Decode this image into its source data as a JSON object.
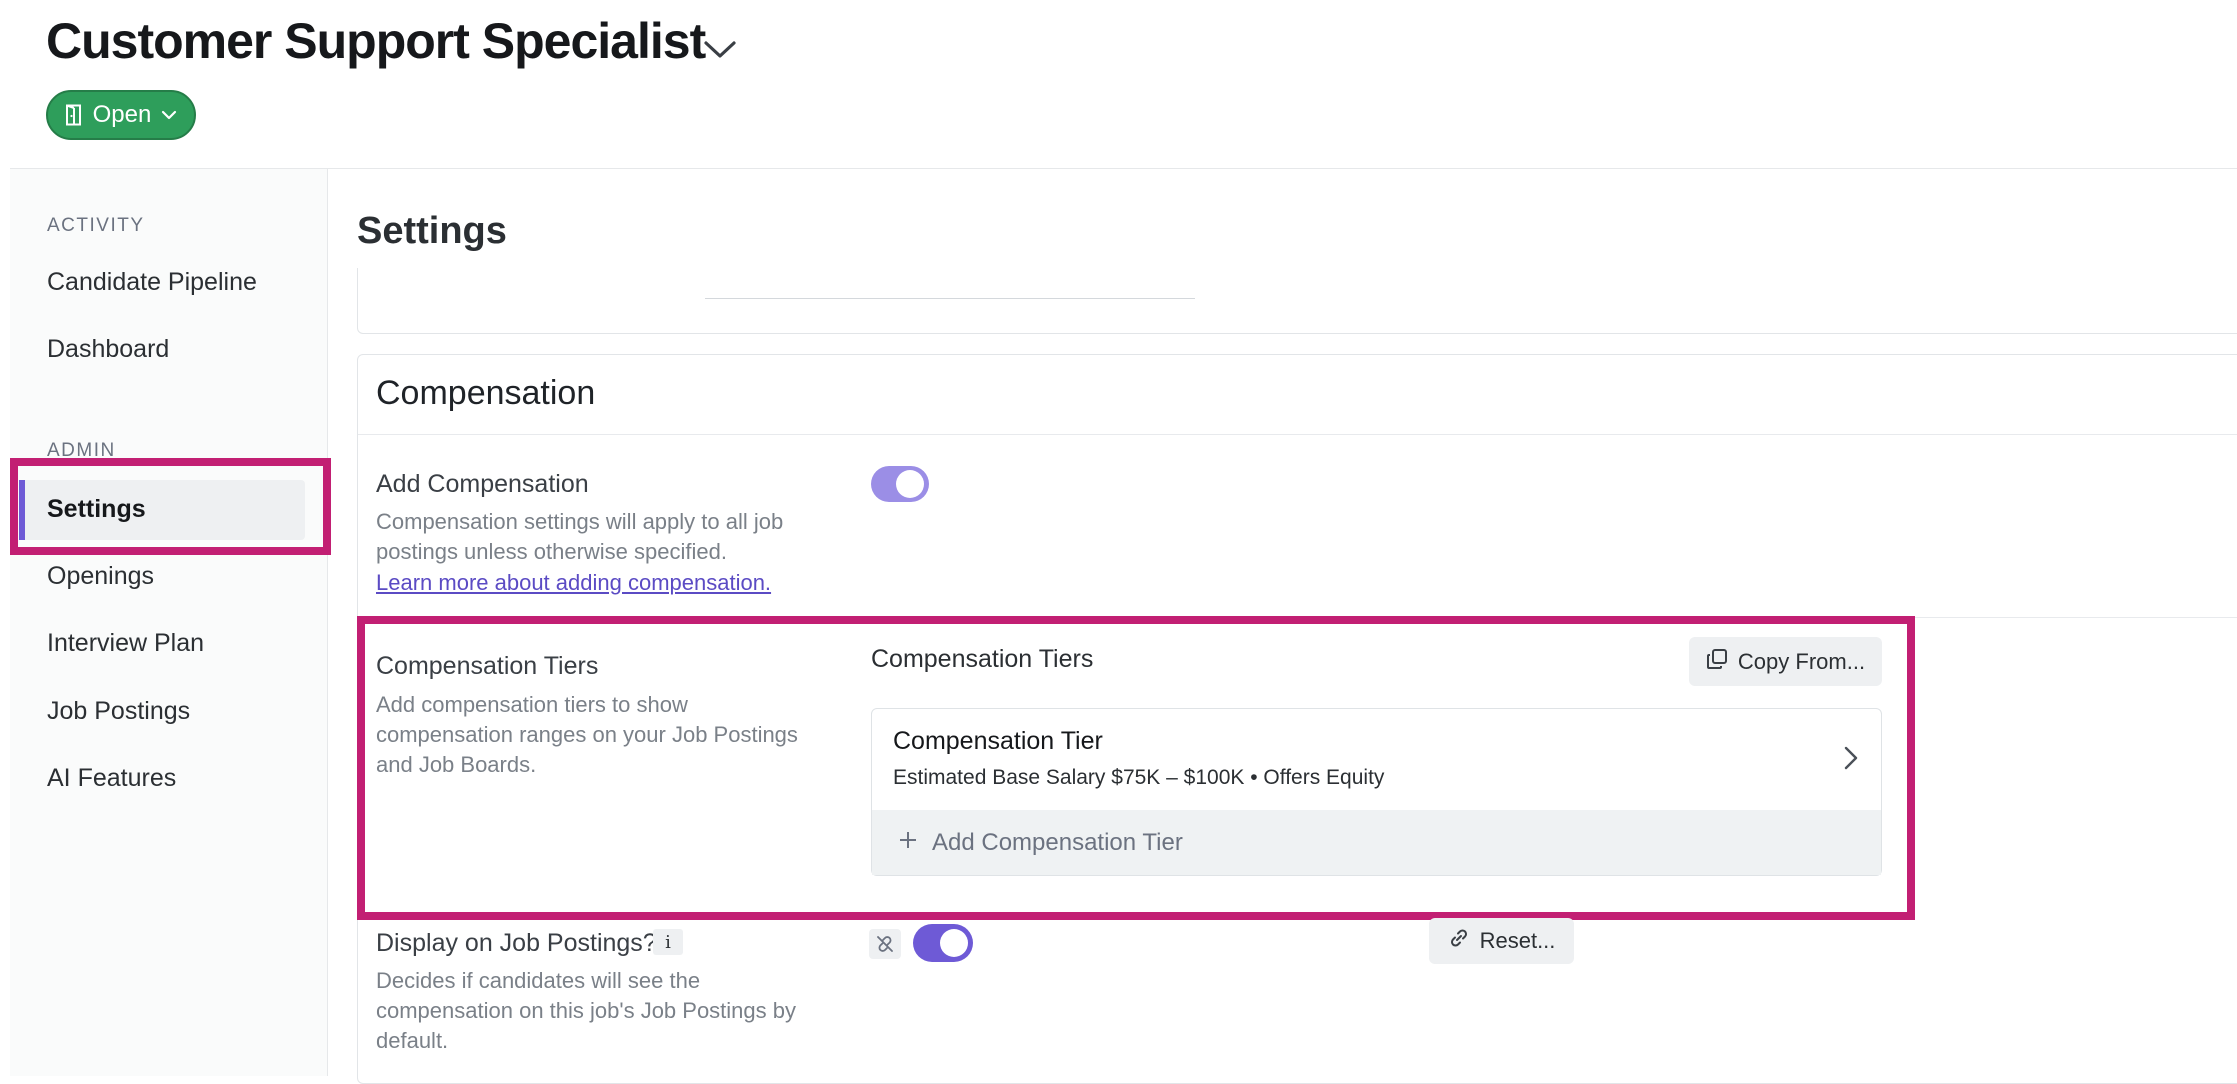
{
  "header": {
    "job_title": "Customer Support Specialist",
    "status_label": "Open"
  },
  "sidebar": {
    "activity_label": "ACTIVITY",
    "activity_items": [
      "Candidate Pipeline",
      "Dashboard"
    ],
    "admin_label": "ADMIN",
    "admin_items": [
      "Settings",
      "Openings",
      "Interview Plan",
      "Job Postings",
      "AI Features"
    ],
    "active_item": "Settings"
  },
  "main": {
    "title": "Settings",
    "compensation": {
      "heading": "Compensation",
      "add_compensation": {
        "title": "Add Compensation",
        "description": "Compensation settings will apply to all job postings unless otherwise specified.",
        "link": "Learn more about adding compensation.",
        "enabled": true
      },
      "tiers": {
        "title": "Compensation Tiers",
        "description": "Add compensation tiers to show compensation ranges on your Job Postings and Job Boards.",
        "panel_label": "Compensation Tiers",
        "copy_button": "Copy From...",
        "items": [
          {
            "name": "Compensation Tier",
            "detail": "Estimated Base Salary $75K – $100K • Offers Equity"
          }
        ],
        "add_label": "Add Compensation Tier"
      },
      "display": {
        "title": "Display on Job Postings?",
        "info": "i",
        "description": "Decides if candidates will see the compensation on this job's Job Postings by default.",
        "enabled": true,
        "reset_button": "Reset..."
      }
    }
  },
  "colors": {
    "status_green": "#2e9e5b",
    "toggle_purple": "#6e5ad6",
    "toggle_light_purple": "#9b8ee6",
    "highlight_magenta": "#c21f73"
  }
}
